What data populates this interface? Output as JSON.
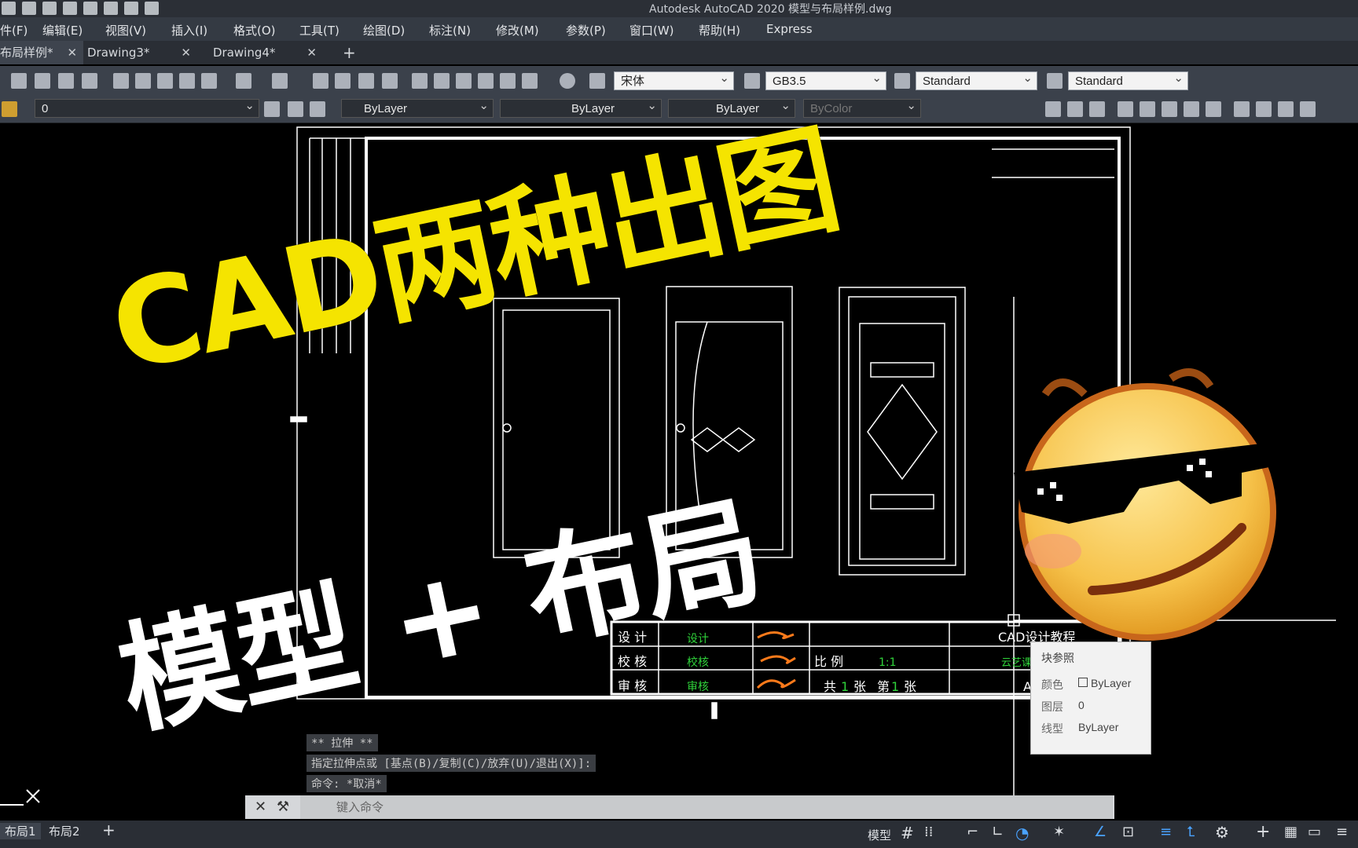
{
  "window": {
    "title": "Autodesk AutoCAD 2020    模型与布局样例.dwg"
  },
  "menu": [
    "件(F)",
    "编辑(E)",
    "视图(V)",
    "插入(I)",
    "格式(O)",
    "工具(T)",
    "绘图(D)",
    "标注(N)",
    "修改(M)",
    "参数(P)",
    "窗口(W)",
    "帮助(H)",
    "Express"
  ],
  "tabs": [
    {
      "label": "布局样例*"
    },
    {
      "label": "Drawing3*"
    },
    {
      "label": "Drawing4*"
    }
  ],
  "toolbar": {
    "text_style": "宋体",
    "dim_style": "GB3.5",
    "table_style": "Standard",
    "multileader_style": "Standard",
    "layer": "0",
    "color": "ByLayer",
    "linetype": "ByLayer",
    "lineweight": "ByLayer",
    "plot_style": "ByColor"
  },
  "title_block": {
    "row1": [
      "设 计",
      "设计"
    ],
    "row2": [
      "校 核",
      "校核",
      "比 例",
      "1:1"
    ],
    "row3": [
      "审 核",
      "审核",
      "共",
      "1",
      "张",
      "第",
      "1",
      "张"
    ],
    "company": "CAD设计教程",
    "company2": "云艺课堂",
    "sheet": "A"
  },
  "tooltip": {
    "title": "块参照",
    "rows": [
      {
        "k": "颜色",
        "v": "ByLayer"
      },
      {
        "k": "图层",
        "v": "0"
      },
      {
        "k": "线型",
        "v": "ByLayer"
      }
    ]
  },
  "command": {
    "history": [
      "** 拉伸 **",
      "指定拉伸点或 [基点(B)/复制(C)/放弃(U)/退出(X)]:",
      "命令: *取消*"
    ],
    "placeholder": "键入命令"
  },
  "layout_tabs": [
    "布局1",
    "布局2"
  ],
  "status": {
    "model_label": "模型"
  },
  "overlay": {
    "line1": "CAD两种出图",
    "line2": "模型 + 布局"
  },
  "colors": {
    "accent_yellow": "#f5e400",
    "drawing_line": "#ffffff",
    "green_text": "#2fd23a"
  }
}
